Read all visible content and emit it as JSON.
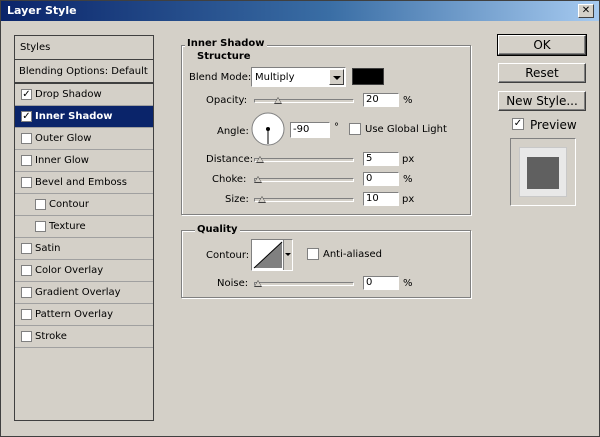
{
  "window": {
    "title": "Layer Style",
    "close_label": "✕"
  },
  "sidebar": {
    "header": "Styles",
    "blending": "Blending Options: Default",
    "items": [
      {
        "label": "Drop Shadow",
        "checked": true
      },
      {
        "label": "Inner Shadow",
        "checked": true,
        "selected": true
      },
      {
        "label": "Outer Glow",
        "checked": false
      },
      {
        "label": "Inner Glow",
        "checked": false
      },
      {
        "label": "Bevel and Emboss",
        "checked": false
      },
      {
        "label": "Contour",
        "checked": false,
        "indent": true
      },
      {
        "label": "Texture",
        "checked": false,
        "indent": true
      },
      {
        "label": "Satin",
        "checked": false
      },
      {
        "label": "Color Overlay",
        "checked": false
      },
      {
        "label": "Gradient Overlay",
        "checked": false
      },
      {
        "label": "Pattern Overlay",
        "checked": false
      },
      {
        "label": "Stroke",
        "checked": false
      }
    ]
  },
  "panel": {
    "title": "Inner Shadow",
    "structure": {
      "legend": "Structure",
      "blend_mode_label": "Blend Mode:",
      "blend_mode_value": "Multiply",
      "shadow_color": "#000000",
      "opacity_label": "Opacity:",
      "opacity_value": "20",
      "opacity_unit": "%",
      "opacity_level": 0.2,
      "angle_label": "Angle:",
      "angle_value": "-90",
      "angle_unit": "°",
      "use_global_light_label": "Use Global Light",
      "use_global_light": false,
      "distance_label": "Distance:",
      "distance_value": "5",
      "distance_unit": "px",
      "distance_level": 0.02,
      "choke_label": "Choke:",
      "choke_value": "0",
      "choke_unit": "%",
      "choke_level": 0.0,
      "size_label": "Size:",
      "size_value": "10",
      "size_unit": "px",
      "size_level": 0.04
    },
    "quality": {
      "legend": "Quality",
      "contour_label": "Contour:",
      "anti_aliased_label": "Anti-aliased",
      "anti_aliased": false,
      "noise_label": "Noise:",
      "noise_value": "0",
      "noise_unit": "%",
      "noise_level": 0.0
    }
  },
  "buttons": {
    "ok": "OK",
    "reset": "Reset",
    "new_style": "New Style...",
    "preview_label": "Preview",
    "preview_checked": true
  },
  "colors": {
    "selection": "#0a246a",
    "face": "#d4d0c8",
    "preview_swatch": "#606060"
  }
}
